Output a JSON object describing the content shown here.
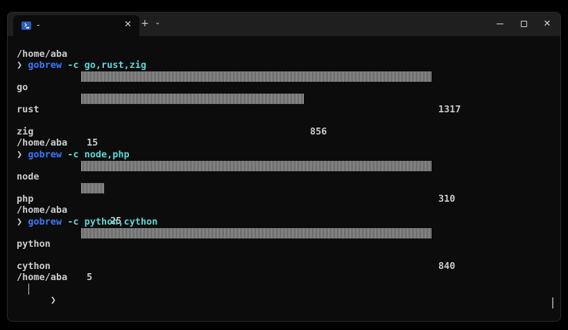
{
  "window": {
    "tab_title": "-",
    "tab_close": "✕",
    "new_tab": "+",
    "dropdown": "⌄",
    "close_glyph": "✕",
    "icon": "powershell-icon"
  },
  "prompt_symbol": "❯",
  "blocks": [
    {
      "cwd": "/home/aba",
      "command": "gobrew",
      "args": "-c go,rust,zig",
      "results": [
        {
          "name": "go",
          "count": "1317",
          "fraction": 1.0
        },
        {
          "name": "rust",
          "count": "856",
          "fraction": 0.65
        },
        {
          "name": "zig",
          "count": "15",
          "fraction": 0.0
        }
      ]
    },
    {
      "cwd": "/home/aba",
      "command": "gobrew",
      "args": "-c node,php",
      "results": [
        {
          "name": "node",
          "count": "310",
          "fraction": 1.0
        },
        {
          "name": "php",
          "count": "25",
          "fraction": 0.07
        }
      ]
    },
    {
      "cwd": "/home/aba",
      "command": "gobrew",
      "args": "-c python,cython",
      "results": [
        {
          "name": "python",
          "count": "840",
          "fraction": 1.0
        },
        {
          "name": "cython",
          "count": "5",
          "fraction": 0.0
        }
      ]
    }
  ],
  "final_cwd": "/home/aba",
  "colors": {
    "command": "#3b78ff",
    "args": "#61d6d6",
    "text": "#cccccc",
    "background": "#0c0c0c"
  }
}
